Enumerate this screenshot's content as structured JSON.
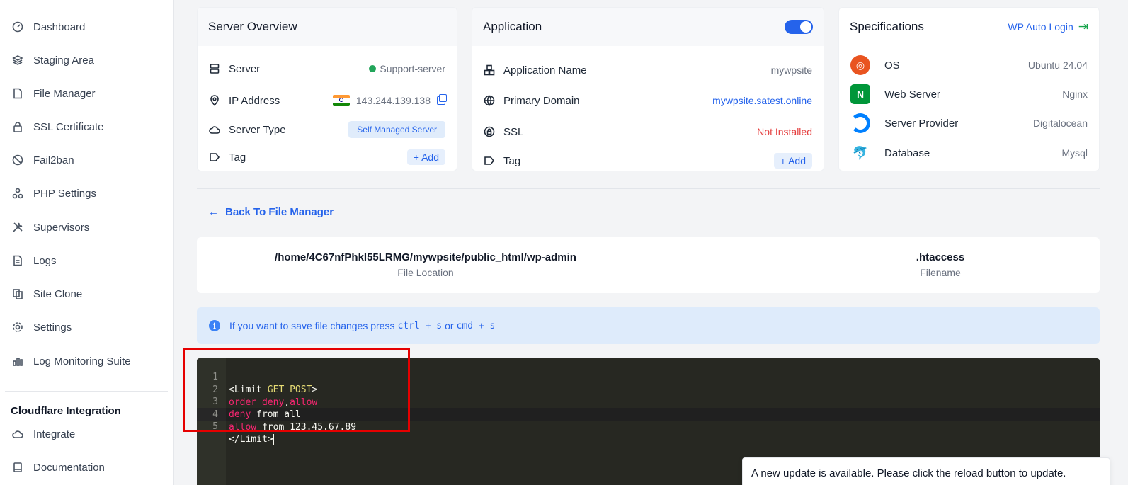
{
  "sidebar": {
    "items": [
      {
        "label": "Dashboard",
        "icon": "gauge-icon"
      },
      {
        "label": "Staging Area",
        "icon": "layers-icon"
      },
      {
        "label": "File Manager",
        "icon": "file-icon"
      },
      {
        "label": "SSL Certificate",
        "icon": "lock-icon"
      },
      {
        "label": "Fail2ban",
        "icon": "ban-icon"
      },
      {
        "label": "PHP Settings",
        "icon": "nodes-icon"
      },
      {
        "label": "Supervisors",
        "icon": "tools-icon"
      },
      {
        "label": "Logs",
        "icon": "document-icon"
      },
      {
        "label": "Site Clone",
        "icon": "clone-icon"
      },
      {
        "label": "Settings",
        "icon": "gear-icon"
      },
      {
        "label": "Log Monitoring Suite",
        "icon": "bar-chart-icon"
      }
    ],
    "section_heading": "Cloudflare Integration",
    "section_items": [
      {
        "label": "Integrate",
        "icon": "cloud-icon"
      },
      {
        "label": "Documentation",
        "icon": "book-icon"
      }
    ]
  },
  "server_overview": {
    "title": "Server Overview",
    "server_label": "Server",
    "server_value": "Support-server",
    "status_color": "#22a55a",
    "ip_label": "IP Address",
    "ip_value": "143.244.139.138",
    "type_label": "Server Type",
    "type_value": "Self Managed Server",
    "tag_label": "Tag",
    "add_label": "+ Add"
  },
  "application": {
    "title": "Application",
    "toggle_on": true,
    "name_label": "Application Name",
    "name_value": "mywpsite",
    "domain_label": "Primary Domain",
    "domain_value": "mywpsite.satest.online",
    "ssl_label": "SSL",
    "ssl_value": "Not Installed",
    "tag_label": "Tag",
    "add_label": "+ Add"
  },
  "specifications": {
    "title": "Specifications",
    "auto_login": "WP Auto Login",
    "os_label": "OS",
    "os_value": "Ubuntu 24.04",
    "web_label": "Web Server",
    "web_value": "Nginx",
    "provider_label": "Server Provider",
    "provider_value": "Digitalocean",
    "db_label": "Database",
    "db_value": "Mysql"
  },
  "file_editor": {
    "back_label": "Back To File Manager",
    "file_location": "/home/4C67nfPhkI55LRMG/mywpsite/public_html/wp-admin",
    "file_location_caption": "File Location",
    "filename": ".htaccess",
    "filename_caption": "Filename",
    "alert_prefix": "If you want to save file changes press",
    "alert_key1": "ctrl + s",
    "alert_or": "or",
    "alert_key2": "cmd + s",
    "lines": [
      {
        "num": "1",
        "a": "<Limit ",
        "b": "GET POST",
        "c": ">"
      },
      {
        "num": "2",
        "a": "order deny",
        "b": ",",
        "c": "allow"
      },
      {
        "num": "3",
        "a": "deny",
        "b": " from all",
        "c": ""
      },
      {
        "num": "4",
        "a": "allow",
        "b": " from 123.45.67.89",
        "c": ""
      },
      {
        "num": "5",
        "a": "</Limit>",
        "b": "",
        "c": ""
      }
    ]
  },
  "toast": {
    "message": "A new update is available. Please click the reload button to update."
  }
}
